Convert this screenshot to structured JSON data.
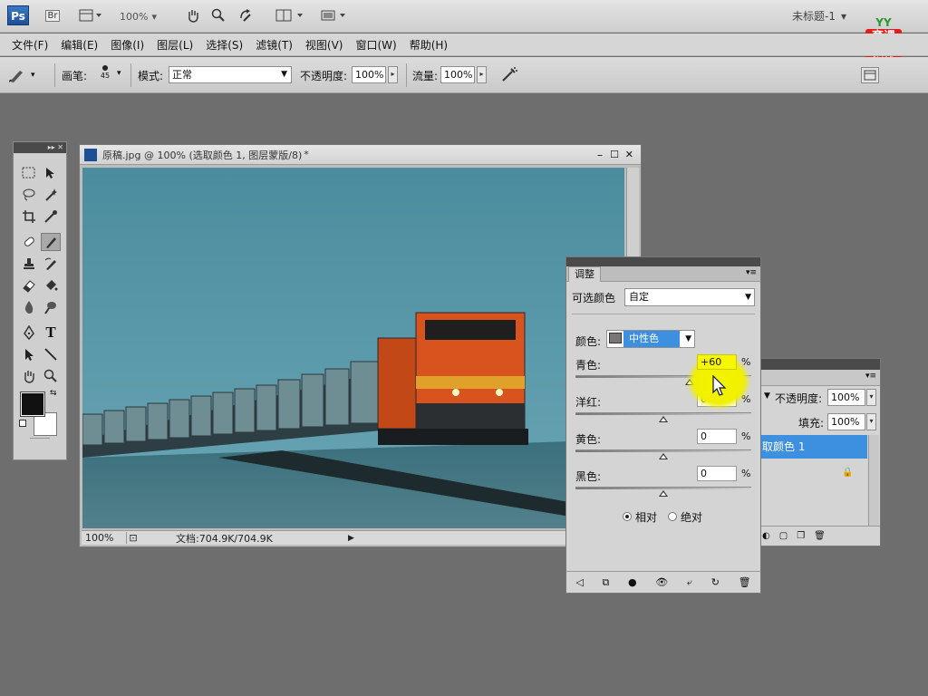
{
  "app": {
    "logo": "Ps",
    "zoom": "100%",
    "doc_menu": "未标题-1"
  },
  "brand": {
    "line1": "育",
    "line2": "课",
    "line3": "教育",
    "letters": "YY"
  },
  "menubar": {
    "items": [
      "文件(F)",
      "编辑(E)",
      "图像(I)",
      "图层(L)",
      "选择(S)",
      "滤镜(T)",
      "视图(V)",
      "窗口(W)",
      "帮助(H)"
    ]
  },
  "options": {
    "brush_label": "画笔:",
    "brush_size": "45",
    "mode_label": "模式:",
    "mode_value": "正常",
    "opacity_label": "不透明度:",
    "opacity_value": "100%",
    "flow_label": "流量:",
    "flow_value": "100%"
  },
  "document": {
    "title": "原稿.jpg @ 100% (选取颜色 1, 图层蒙版/8)",
    "title_suffix": "*",
    "status_zoom": "100%",
    "status_doc": "文档:704.9K/704.9K"
  },
  "adjustments": {
    "tab": "调整",
    "preset_label": "可选颜色",
    "preset_value": "自定",
    "color_label": "颜色:",
    "color_value": "中性色",
    "sliders": [
      {
        "label": "青色:",
        "value": "+60",
        "pct": "%",
        "level": 0.65
      },
      {
        "label": "洋红:",
        "value": "0",
        "pct": "%",
        "level": 0.5
      },
      {
        "label": "黄色:",
        "value": "0",
        "pct": "%",
        "level": 0.5
      },
      {
        "label": "黑色:",
        "value": "0",
        "pct": "%",
        "level": 0.5
      }
    ],
    "radio_relative": "相对",
    "radio_absolute": "绝对"
  },
  "layers": {
    "opacity_label": "不透明度:",
    "opacity_value": "100%",
    "fill_label": "填充:",
    "fill_value": "100%",
    "layer_name": "取颜色 1"
  },
  "colors": {
    "selection_blue": "#3d8fe0",
    "sky": "#4f8fa1",
    "engine_orange": "#d9531e"
  }
}
